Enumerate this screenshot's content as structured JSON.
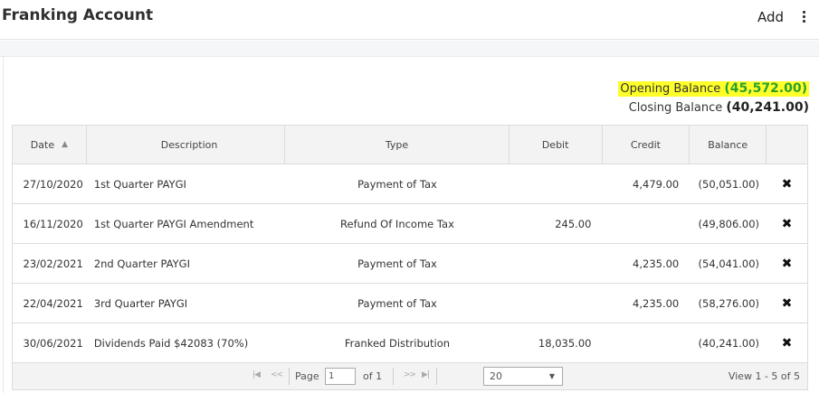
{
  "header": {
    "title": "Franking Account",
    "add_label": "Add"
  },
  "balances": {
    "opening_label": "Opening Balance",
    "opening_value": "(45,572.00)",
    "closing_label": "Closing Balance",
    "closing_value": "(40,241.00)"
  },
  "table": {
    "columns": [
      "Date",
      "Description",
      "Type",
      "Debit",
      "Credit",
      "Balance"
    ],
    "rows": [
      {
        "date": "27/10/2020",
        "description": "1st Quarter PAYGI",
        "type": "Payment of Tax",
        "debit": "",
        "credit": "4,479.00",
        "balance": "(50,051.00)"
      },
      {
        "date": "16/11/2020",
        "description": "1st Quarter PAYGI Amendment",
        "type": "Refund Of Income Tax",
        "debit": "245.00",
        "credit": "",
        "balance": "(49,806.00)"
      },
      {
        "date": "23/02/2021",
        "description": "2nd Quarter PAYGI",
        "type": "Payment of Tax",
        "debit": "",
        "credit": "4,235.00",
        "balance": "(54,041.00)"
      },
      {
        "date": "22/04/2021",
        "description": "3rd Quarter PAYGI",
        "type": "Payment of Tax",
        "debit": "",
        "credit": "4,235.00",
        "balance": "(58,276.00)"
      },
      {
        "date": "30/06/2021",
        "description": "Dividends Paid $42083 (70%)",
        "type": "Franked Distribution",
        "debit": "18,035.00",
        "credit": "",
        "balance": "(40,241.00)"
      }
    ],
    "delete_glyph": "✖"
  },
  "pager": {
    "page_label": "Page",
    "page_value": "1",
    "of_label": "of 1",
    "page_size": "20",
    "view_text": "View 1 - 5 of 5"
  },
  "colors": {
    "highlight": "#ffff2a",
    "opening_value": "#2ca02c"
  }
}
